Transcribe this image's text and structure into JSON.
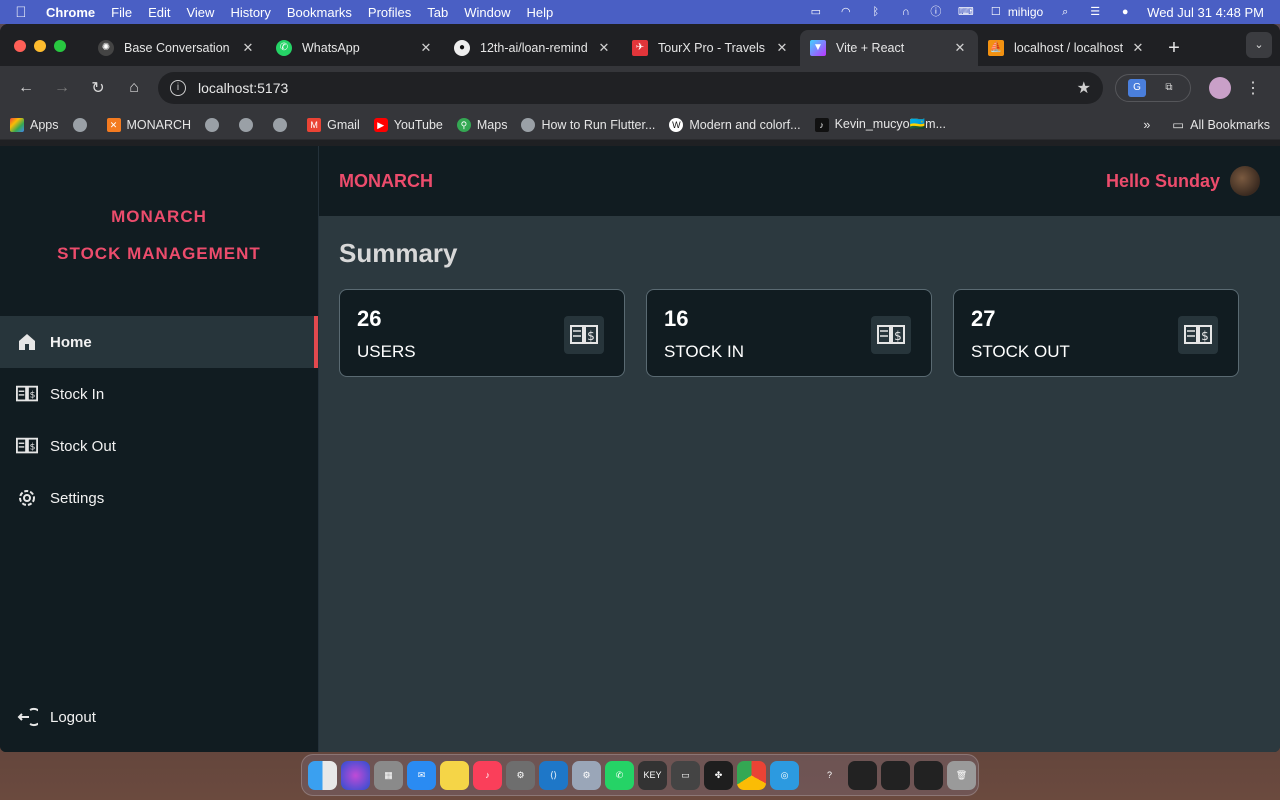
{
  "menubar": {
    "app_name": "Chrome",
    "items": [
      "File",
      "Edit",
      "View",
      "History",
      "Bookmarks",
      "Profiles",
      "Tab",
      "Window",
      "Help"
    ],
    "user": "mihigo",
    "datetime": "Wed Jul 31  4:48 PM"
  },
  "browser": {
    "tabs": [
      {
        "label": "Base Conversation",
        "icon": "openai-icon"
      },
      {
        "label": "WhatsApp",
        "icon": "whatsapp-icon"
      },
      {
        "label": "12th-ai/loan-remind",
        "icon": "github-icon"
      },
      {
        "label": "TourX Pro - Travels",
        "icon": "tourx-icon"
      },
      {
        "label": "Vite + React",
        "icon": "vite-icon",
        "active": true
      },
      {
        "label": "localhost / localhost",
        "icon": "phpmyadmin-icon"
      }
    ],
    "url": "localhost:5173",
    "bookmarks": [
      {
        "label": "Apps"
      },
      {
        "label": ""
      },
      {
        "label": "MONARCH"
      },
      {
        "label": ""
      },
      {
        "label": ""
      },
      {
        "label": ""
      },
      {
        "label": "Gmail"
      },
      {
        "label": "YouTube"
      },
      {
        "label": "Maps"
      },
      {
        "label": "How to Run Flutter..."
      },
      {
        "label": "Modern and colorf..."
      },
      {
        "label": "Kevin_mucyo🇷🇼m..."
      }
    ],
    "all_bookmarks": "All Bookmarks"
  },
  "sidebar": {
    "brand_line1": "MONARCH",
    "brand_line2": "STOCK MANAGEMENT",
    "items": [
      {
        "label": "Home",
        "icon": "home-icon",
        "active": true
      },
      {
        "label": "Stock In",
        "icon": "stock-book-icon"
      },
      {
        "label": "Stock Out",
        "icon": "stock-book-icon"
      },
      {
        "label": "Settings",
        "icon": "gear-icon"
      }
    ],
    "logout": "Logout"
  },
  "header": {
    "brand": "MONARCH",
    "greeting": "Hello Sunday"
  },
  "main": {
    "title": "Summary",
    "cards": [
      {
        "count": "26",
        "label": "USERS"
      },
      {
        "count": "16",
        "label": "STOCK IN"
      },
      {
        "count": "27",
        "label": "STOCK OUT"
      }
    ]
  },
  "colors": {
    "accent": "#ec4c6c",
    "active_indicator": "#e2494e",
    "sidebar_bg": "#111c21",
    "main_bg": "#2c393f"
  }
}
